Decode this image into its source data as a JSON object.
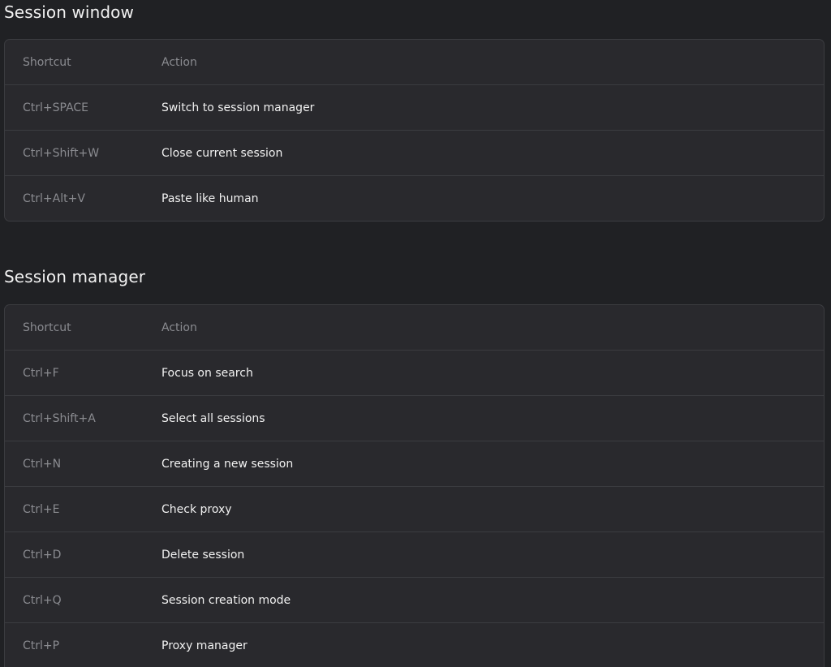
{
  "session_window": {
    "title": "Session window",
    "header": {
      "shortcut": "Shortcut",
      "action": "Action"
    },
    "rows": [
      {
        "shortcut": "Ctrl+SPACE",
        "action": "Switch to session manager"
      },
      {
        "shortcut": "Ctrl+Shift+W",
        "action": "Close current session"
      },
      {
        "shortcut": "Ctrl+Alt+V",
        "action": "Paste like human"
      }
    ]
  },
  "session_manager": {
    "title": "Session manager",
    "header": {
      "shortcut": "Shortcut",
      "action": "Action"
    },
    "rows": [
      {
        "shortcut": "Ctrl+F",
        "action": "Focus on search"
      },
      {
        "shortcut": "Ctrl+Shift+A",
        "action": "Select all sessions"
      },
      {
        "shortcut": "Ctrl+N",
        "action": "Creating a new session"
      },
      {
        "shortcut": "Ctrl+E",
        "action": "Check proxy"
      },
      {
        "shortcut": "Ctrl+D",
        "action": "Delete session"
      },
      {
        "shortcut": "Ctrl+Q",
        "action": "Session creation mode"
      },
      {
        "shortcut": "Ctrl+P",
        "action": "Proxy manager"
      }
    ]
  }
}
